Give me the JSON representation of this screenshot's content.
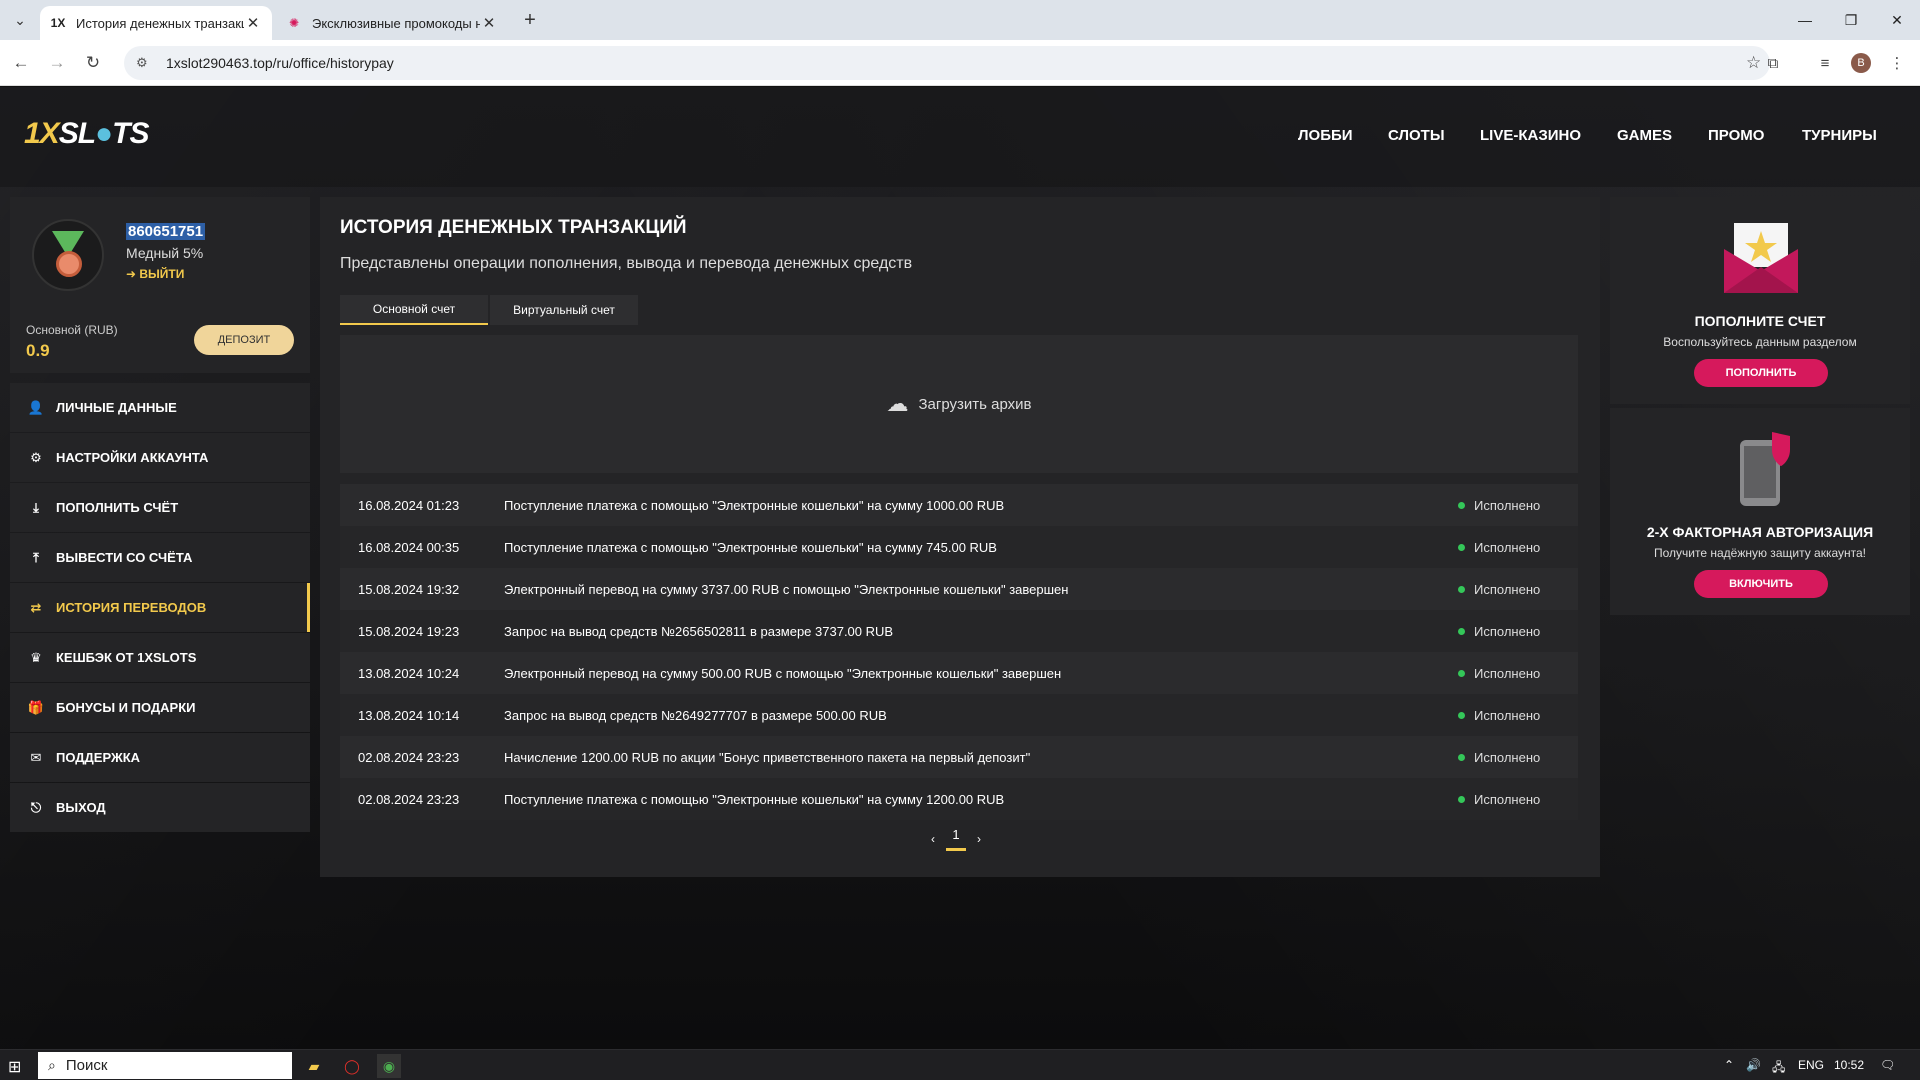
{
  "browser": {
    "tabs": [
      {
        "title": "История денежных транзакций",
        "active": true
      },
      {
        "title": "Эксклюзивные промокоды на",
        "active": false
      }
    ],
    "url": "1xslot290463.top/ru/office/historypay",
    "profile_initial": "B"
  },
  "site": {
    "logo_1": "1X",
    "logo_2": "SL",
    "logo_3": "TS",
    "nav": [
      "ЛОББИ",
      "СЛОТЫ",
      "LIVE-КАЗИНО",
      "GAMES",
      "ПРОМО",
      "ТУРНИРЫ"
    ]
  },
  "profile": {
    "user_id": "860651751",
    "level": "Медный 5%",
    "logout": "ВЫЙТИ",
    "balance_label": "Основной (RUB)",
    "balance_value": "0.9",
    "deposit_label": "ДЕПОЗИТ"
  },
  "menu": [
    {
      "icon": "user-icon",
      "label": "ЛИЧНЫЕ ДАННЫЕ",
      "active": false
    },
    {
      "icon": "user-settings-icon",
      "label": "НАСТРОЙКИ АККАУНТА",
      "active": false
    },
    {
      "icon": "download-icon",
      "label": "ПОПОЛНИТЬ СЧЁТ",
      "active": false
    },
    {
      "icon": "upload-icon",
      "label": "ВЫВЕСТИ СО СЧЁТА",
      "active": false
    },
    {
      "icon": "transfer-icon",
      "label": "ИСТОРИЯ ПЕРЕВОДОВ",
      "active": true
    },
    {
      "icon": "crown-icon",
      "label": "КЕШБЭК ОТ 1XSLOTS",
      "active": false
    },
    {
      "icon": "gift-icon",
      "label": "БОНУСЫ И ПОДАРКИ",
      "active": false
    },
    {
      "icon": "mail-icon",
      "label": "ПОДДЕРЖКА",
      "active": false
    },
    {
      "icon": "exit-icon",
      "label": "ВЫХОД",
      "active": false
    }
  ],
  "main": {
    "title": "ИСТОРИЯ ДЕНЕЖНЫХ ТРАНЗАКЦИЙ",
    "subtitle": "Представлены операции пополнения, вывода и перевода денежных средств",
    "account_tabs": [
      {
        "label": "Основной счет",
        "active": true
      },
      {
        "label": "Виртуальный счет",
        "active": false
      }
    ],
    "archive_label": "Загрузить архив",
    "transactions": [
      {
        "date": "16.08.2024 01:23",
        "desc": "Поступление платежа с помощью \"Электронные кошельки\" на сумму 1000.00 RUB",
        "status": "Исполнено"
      },
      {
        "date": "16.08.2024 00:35",
        "desc": "Поступление платежа с помощью \"Электронные кошельки\" на сумму 745.00 RUB",
        "status": "Исполнено"
      },
      {
        "date": "15.08.2024 19:32",
        "desc": "Электронный перевод на сумму 3737.00 RUB с помощью \"Электронные кошельки\" завершен",
        "status": "Исполнено"
      },
      {
        "date": "15.08.2024 19:23",
        "desc": "Запрос на вывод средств №2656502811 в размере 3737.00 RUB",
        "status": "Исполнено"
      },
      {
        "date": "13.08.2024 10:24",
        "desc": "Электронный перевод на сумму 500.00 RUB с помощью \"Электронные кошельки\" завершен",
        "status": "Исполнено"
      },
      {
        "date": "13.08.2024 10:14",
        "desc": "Запрос на вывод средств №2649277707 в размере 500.00 RUB",
        "status": "Исполнено"
      },
      {
        "date": "02.08.2024 23:23",
        "desc": "Начисление 1200.00 RUB по акции \"Бонус приветственного пакета на первый депозит\"",
        "status": "Исполнено"
      },
      {
        "date": "02.08.2024 23:23",
        "desc": "Поступление платежа с помощью \"Электронные кошельки\" на сумму 1200.00 RUB",
        "status": "Исполнено"
      }
    ],
    "page": "1"
  },
  "widgets": {
    "deposit": {
      "title": "ПОПОЛНИТЕ СЧЕТ",
      "subtitle": "Воспользуйтесь данным разделом",
      "button": "ПОПОЛНИТЬ"
    },
    "twofa": {
      "title": "2-Х ФАКТОРНАЯ АВТОРИЗАЦИЯ",
      "subtitle": "Получите надёжную защиту аккаунта!",
      "button": "ВКЛЮЧИТЬ"
    }
  },
  "taskbar": {
    "search_placeholder": "Поиск",
    "lang": "ENG",
    "time": "10:52"
  },
  "colors": {
    "accent": "#f2c94c",
    "button": "#d6195c",
    "status_ok": "#34c759"
  }
}
